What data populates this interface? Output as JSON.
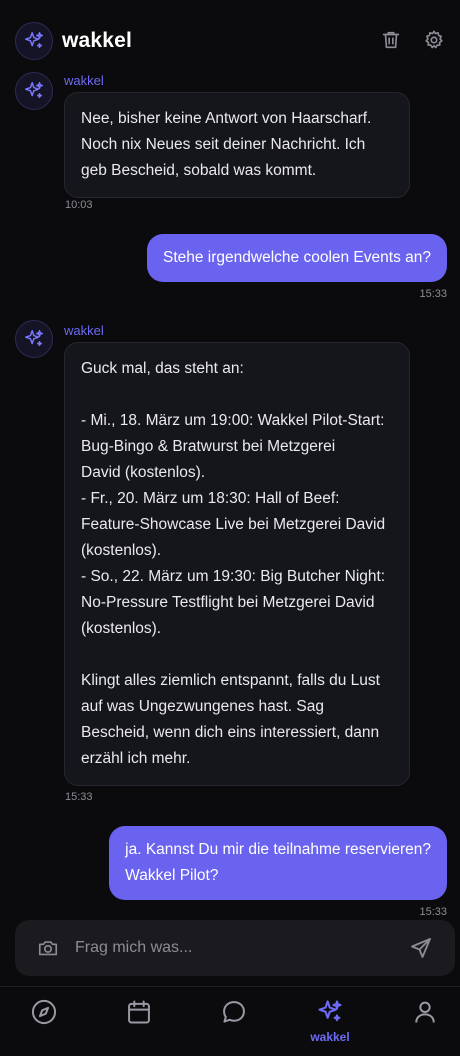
{
  "header": {
    "title": "wakkel"
  },
  "messages": [
    {
      "sender": "wakkel",
      "text": "Nee, bisher keine Antwort von Haarscharf.\nNoch nix Neues seit deiner Nachricht. Ich\ngeb Bescheid, sobald was kommt.",
      "time": "10:03"
    },
    {
      "text": "Stehe irgendwelche coolen Events an?",
      "time": "15:33"
    },
    {
      "sender": "wakkel",
      "text": "Guck mal, das steht an:\n\n- Mi., 18. März um 19:00: Wakkel Pilot-Start:\nBug-Bingo & Bratwurst bei Metzgerei\nDavid (kostenlos).\n- Fr., 20. März um 18:30: Hall of Beef:\nFeature-Showcase Live bei Metzgerei David\n(kostenlos).\n- So., 22. März um 19:30: Big Butcher Night:\nNo-Pressure Testflight bei Metzgerei David\n(kostenlos).\n\nKlingt alles ziemlich entspannt, falls du Lust\nauf was Ungezwungenes hast. Sag\nBescheid, wenn dich eins interessiert, dann\nerzähl ich mehr.",
      "time": "15:33"
    },
    {
      "text": "ja. Kannst Du mir die teilnahme reservieren?\nWakkel Pilot?",
      "time": "15:33"
    }
  ],
  "composer": {
    "placeholder": "Frag mich was..."
  },
  "nav": {
    "active_label": "wakkel"
  },
  "colors": {
    "accent": "#6a63f0",
    "background": "#0b0b0d",
    "bot_bubble": "#15151c"
  },
  "icons": [
    "sparkle-icon",
    "trash-icon",
    "gear-icon",
    "camera-icon",
    "send-icon",
    "compass-icon",
    "calendar-icon",
    "chat-icon",
    "user-icon"
  ]
}
